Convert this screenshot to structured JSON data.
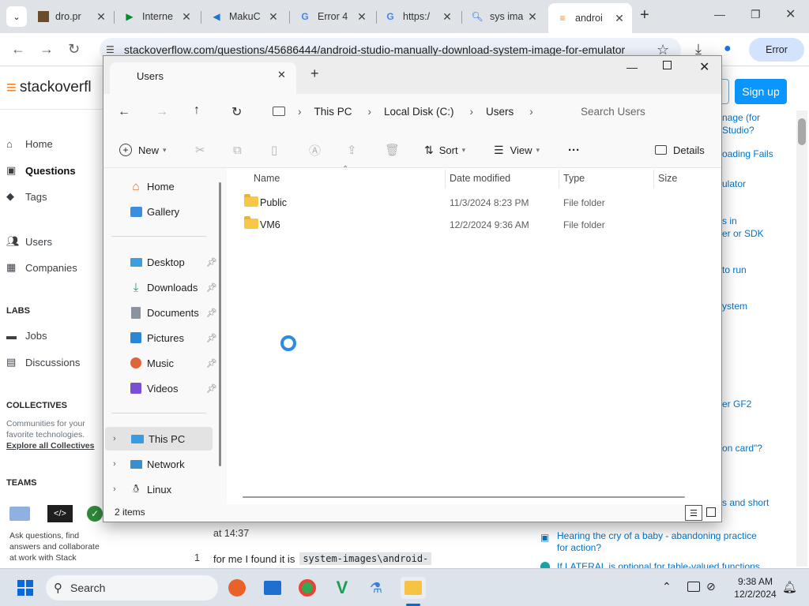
{
  "browser": {
    "tabs": [
      {
        "title": "dro.pr",
        "favicon": "page-icon"
      },
      {
        "title": "Interne",
        "favicon": "play-icon"
      },
      {
        "title": "MakuC",
        "favicon": "edge-icon"
      },
      {
        "title": "Error 4",
        "favicon": "google-icon"
      },
      {
        "title": "https:/",
        "favicon": "google-icon"
      },
      {
        "title": "sys ima",
        "favicon": "search-icon"
      },
      {
        "title": "androi",
        "favicon": "stackoverflow-icon"
      }
    ],
    "new_tab": "+",
    "url": "stackoverflow.com/questions/45686444/android-studio-manually-download-system-image-for-emulator",
    "profile_label": "Error"
  },
  "stackoverflow": {
    "logo_text": "stackoverfl",
    "nav": [
      "Home",
      "Questions",
      "Tags",
      "Users",
      "Companies"
    ],
    "labs_heading": "LABS",
    "labs": [
      "Jobs",
      "Discussions"
    ],
    "collectives_heading": "COLLECTIVES",
    "collectives_text": "Communities for your favorite technologies.",
    "collectives_link": "Explore all Collectives",
    "teams_heading": "TEAMS",
    "teams_text": "Ask questions, find answers and collaborate at work with Stack",
    "signup": "Sign up",
    "right_links": [
      "nage (for",
      "Studio?",
      "oading Fails",
      "ulator",
      "s in",
      "er or SDK",
      "to run",
      "ystem",
      "er GF2",
      "on card\"?",
      "s and short"
    ],
    "hot_links": [
      "Hearing the cry of a baby - abandoning practice for action?",
      "If LATERAL is optional for table-valued functions"
    ],
    "comment_time": "at 14:37",
    "comment_number": "1",
    "comment_text": "for me I found it is",
    "comment_code": "system-images\\android-"
  },
  "explorer": {
    "tab_title": "Users",
    "breadcrumb": [
      "This PC",
      "Local Disk (C:)",
      "Users"
    ],
    "search_placeholder": "Search Users",
    "commands": {
      "new": "New",
      "sort": "Sort",
      "view": "View",
      "more": "···",
      "details": "Details"
    },
    "nav_items": [
      {
        "label": "Home",
        "icon": "home-icon"
      },
      {
        "label": "Gallery",
        "icon": "gallery-icon"
      },
      {
        "label": "Desktop",
        "icon": "desktop-icon"
      },
      {
        "label": "Downloads",
        "icon": "download-icon"
      },
      {
        "label": "Documents",
        "icon": "document-icon"
      },
      {
        "label": "Pictures",
        "icon": "pictures-icon"
      },
      {
        "label": "Music",
        "icon": "music-icon"
      },
      {
        "label": "Videos",
        "icon": "videos-icon"
      },
      {
        "label": "This PC",
        "icon": "computer-icon"
      },
      {
        "label": "Network",
        "icon": "network-icon"
      },
      {
        "label": "Linux",
        "icon": "linux-icon"
      }
    ],
    "columns": [
      "Name",
      "Date modified",
      "Type",
      "Size"
    ],
    "files": [
      {
        "name": "Public",
        "date": "11/3/2024 8:23 PM",
        "type": "File folder"
      },
      {
        "name": "VM6",
        "date": "12/2/2024 9:36 AM",
        "type": "File folder"
      }
    ],
    "status": "2 items"
  },
  "taskbar": {
    "search": "Search",
    "time": "9:38 AM",
    "date": "12/2/2024"
  },
  "colors": {
    "accent": "#0a95ff",
    "so_orange": "#f48024",
    "link": "#0074cc"
  }
}
